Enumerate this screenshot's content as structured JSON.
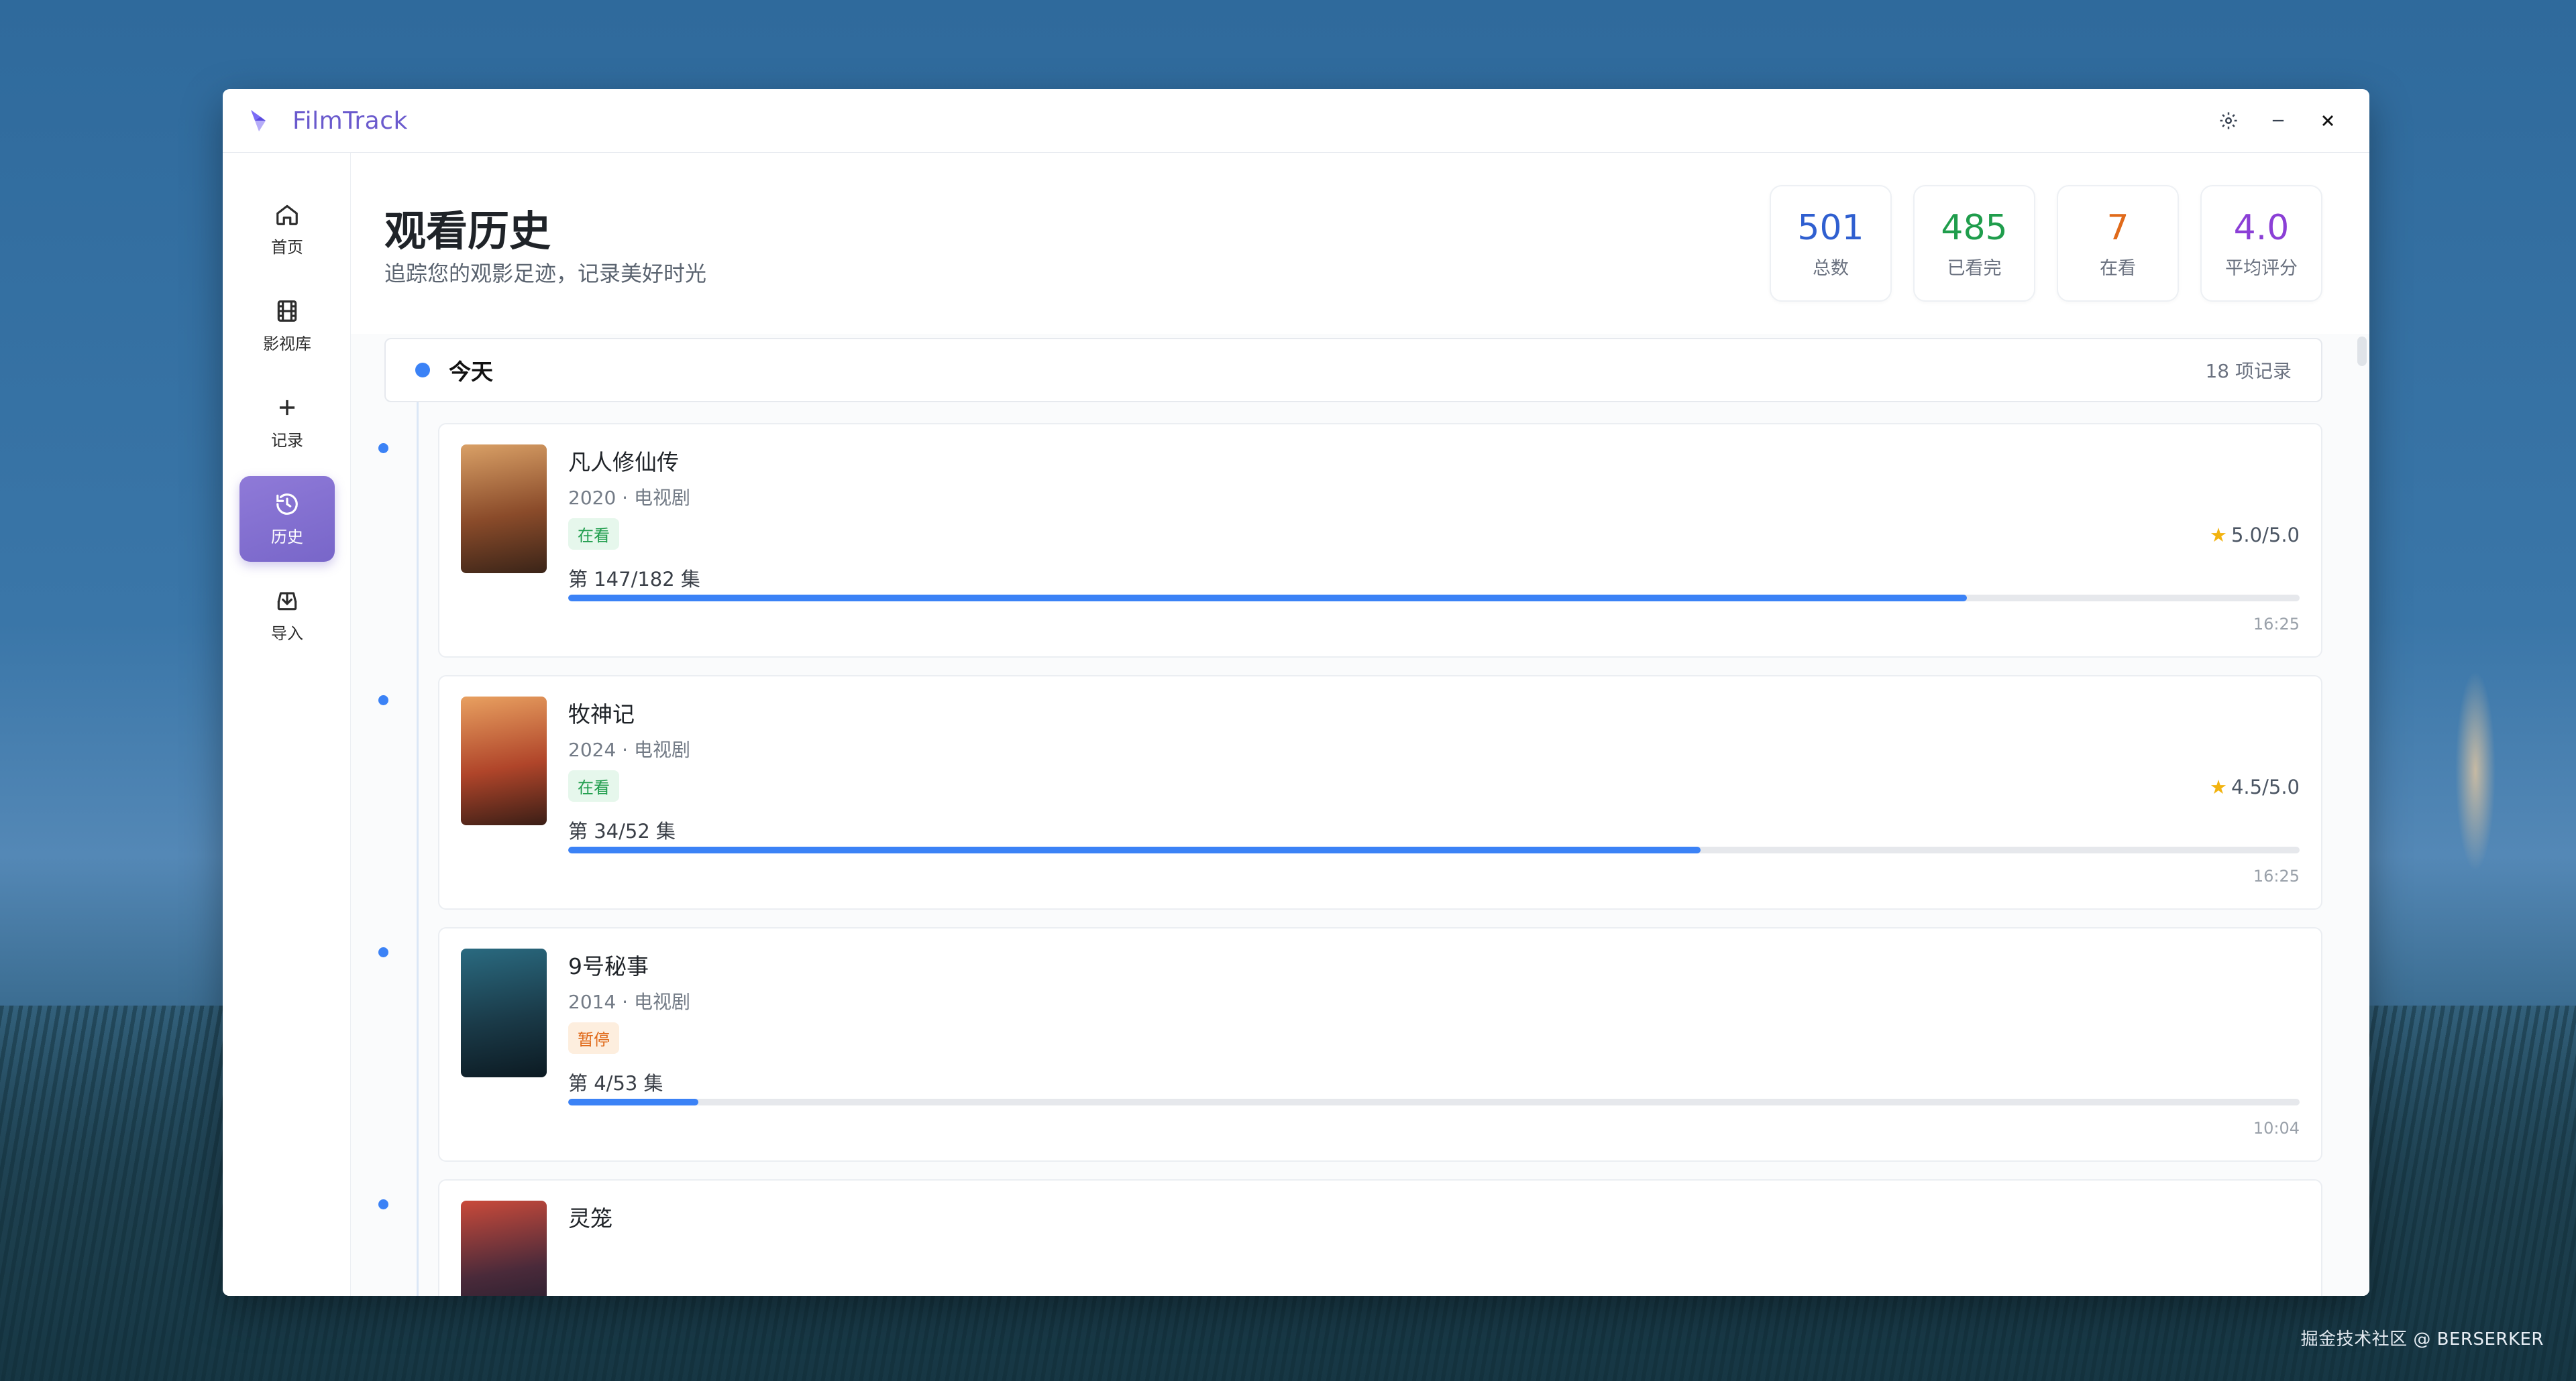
{
  "app": {
    "title": "FilmTrack"
  },
  "window_controls": {
    "settings": "settings-icon",
    "minimize": "minimize-icon",
    "close": "close-icon"
  },
  "sidebar": {
    "items": [
      {
        "label": "首页",
        "icon": "home-icon",
        "active": false
      },
      {
        "label": "影视库",
        "icon": "film-icon",
        "active": false
      },
      {
        "label": "记录",
        "icon": "plus-icon",
        "active": false
      },
      {
        "label": "历史",
        "icon": "history-icon",
        "active": true
      },
      {
        "label": "导入",
        "icon": "import-icon",
        "active": false
      }
    ]
  },
  "header": {
    "title": "观看历史",
    "subtitle": "追踪您的观影足迹，记录美好时光"
  },
  "stats": [
    {
      "value": "501",
      "label": "总数",
      "color": "#2f5fd0"
    },
    {
      "value": "485",
      "label": "已看完",
      "color": "#1f9d4c"
    },
    {
      "value": "7",
      "label": "在看",
      "color": "#e06a1a"
    },
    {
      "value": "4.0",
      "label": "平均评分",
      "color": "#8b3fd6"
    }
  ],
  "day_group": {
    "label": "今天",
    "count": "18 项记录"
  },
  "entries": [
    {
      "title": "凡人修仙传",
      "meta": "2020 · 电视剧",
      "status": "在看",
      "status_type": "watching",
      "rating": "5.0/5.0",
      "progress_text": "第 147/182 集",
      "progress": 0.808,
      "time": "16:25",
      "poster_colors": [
        "#d9a066",
        "#8a4b2a",
        "#3a2418"
      ]
    },
    {
      "title": "牧神记",
      "meta": "2024 · 电视剧",
      "status": "在看",
      "status_type": "watching",
      "rating": "4.5/5.0",
      "progress_text": "第 34/52 集",
      "progress": 0.654,
      "time": "16:25",
      "poster_colors": [
        "#e8a060",
        "#b0452a",
        "#3a1e16"
      ]
    },
    {
      "title": "9号秘事",
      "meta": "2014 · 电视剧",
      "status": "暂停",
      "status_type": "paused",
      "rating": "",
      "progress_text": "第 4/53 集",
      "progress": 0.075,
      "time": "10:04",
      "poster_colors": [
        "#2a6a80",
        "#1a3a48",
        "#0c1a22"
      ]
    },
    {
      "title": "灵笼",
      "meta": "",
      "status": "",
      "status_type": "",
      "rating": "",
      "progress_text": "",
      "progress": 0,
      "time": "",
      "poster_colors": [
        "#c94a3a",
        "#4a2a3a",
        "#1a1a2a"
      ]
    }
  ],
  "watermark": "掘金技术社区 @ BERSERKER"
}
